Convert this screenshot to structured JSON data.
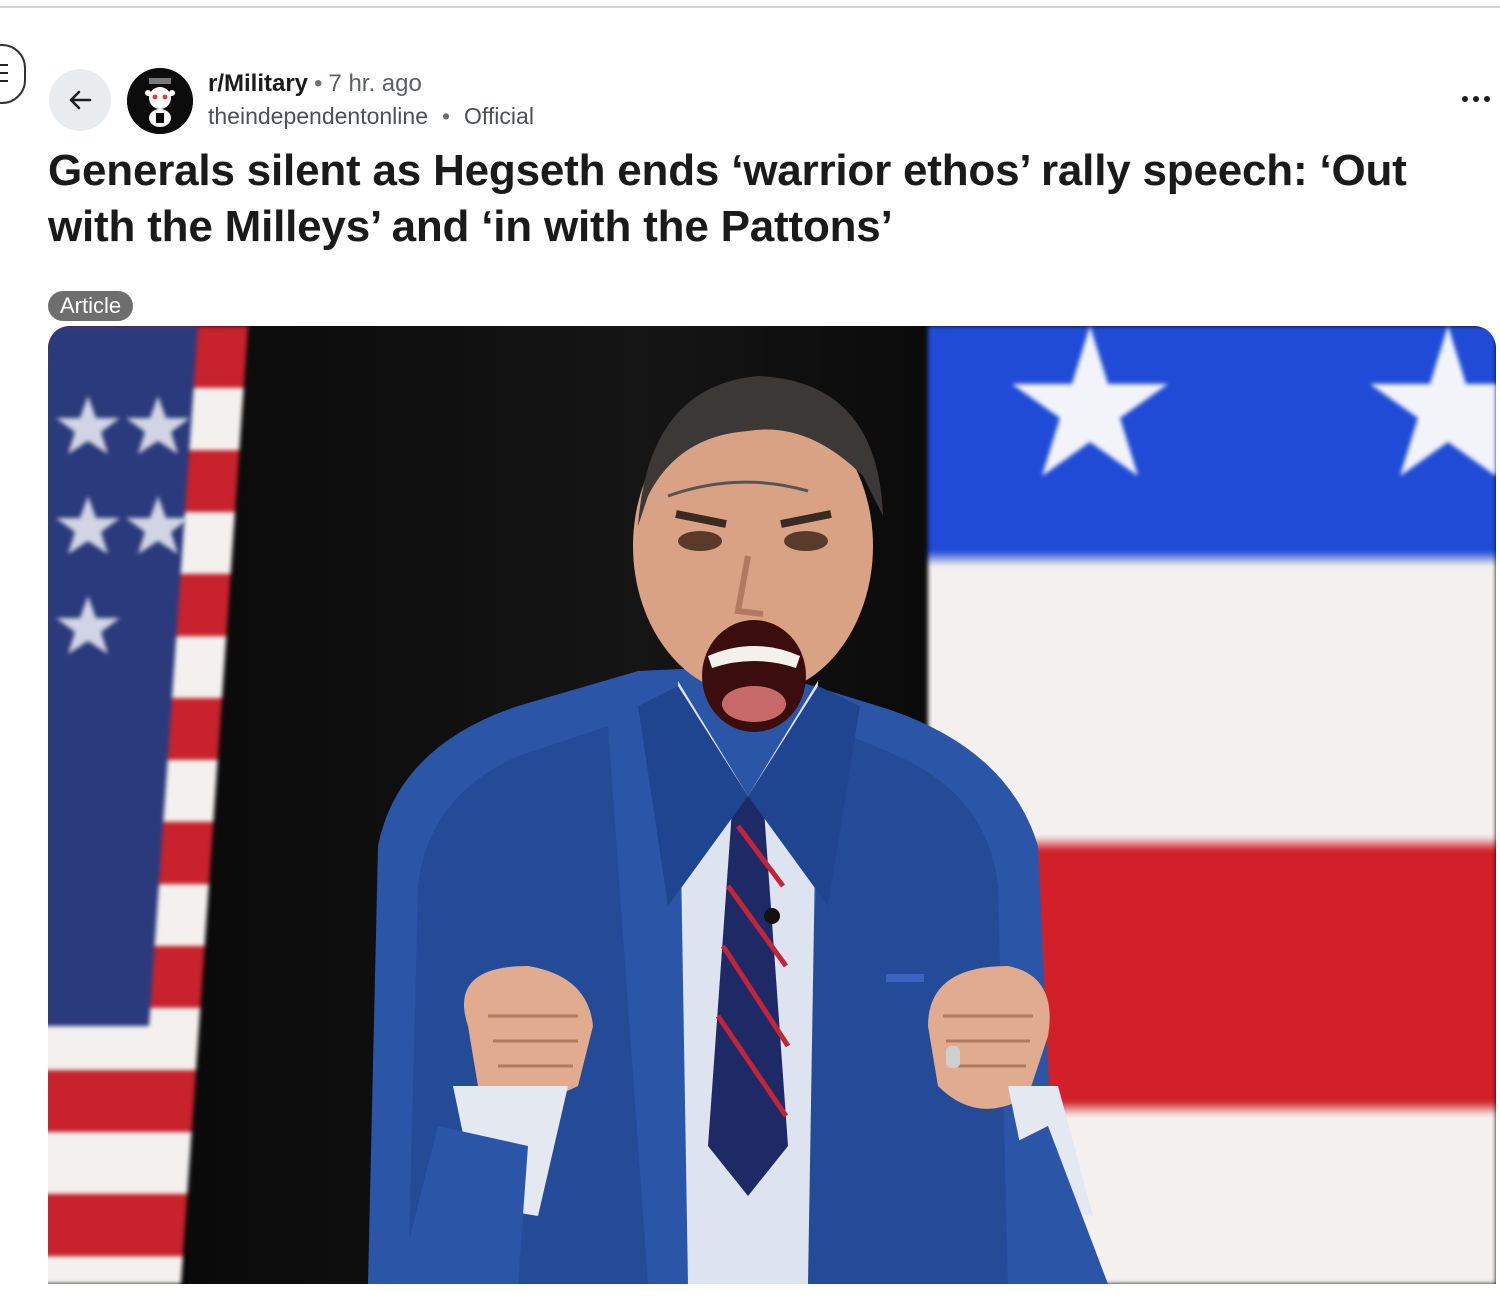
{
  "post": {
    "subreddit": "r/Military",
    "time": "7 hr. ago",
    "separator": "•",
    "author": "theindependentonline",
    "author_flair": "Official",
    "title": "Generals silent as Hegseth ends ‘warrior ethos’ rally speech: ‘Out with the Milleys’ and ‘in with the Pattons’",
    "flair": "Article"
  },
  "icons": {
    "menu": "menu-icon",
    "back": "arrow-left-icon",
    "avatar": "subreddit-avatar-icon",
    "overflow": "more-horizontal-icon"
  },
  "colors": {
    "flair_bg": "#6e6e6e",
    "back_btn_bg": "#e9ecee",
    "meta_text": "#4a5054"
  }
}
